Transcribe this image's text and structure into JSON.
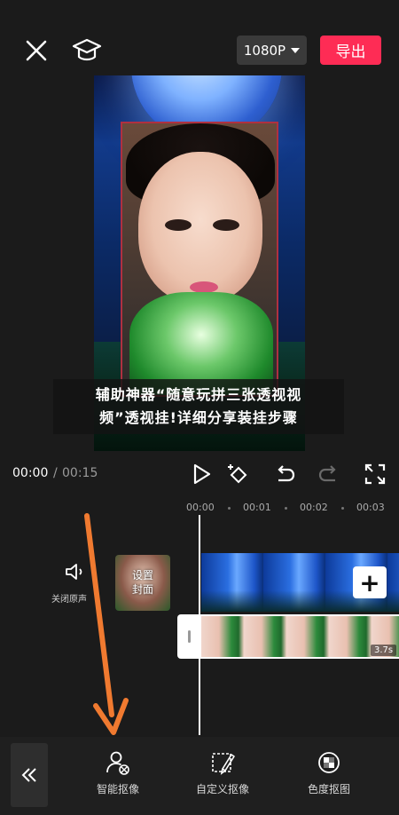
{
  "top_bar": {
    "resolution_label": "1080P",
    "export_label": "导出",
    "export_color": "#fe2c55"
  },
  "caption": {
    "line1": "辅助神器“随意玩拼三张透视视",
    "line2": "频”透视挂!详细分享装挂步骤"
  },
  "playback": {
    "current_time": "00:00",
    "separator": "/",
    "total_time": "00:15"
  },
  "timeline": {
    "ticks": [
      "00:00",
      "00:01",
      "00:02",
      "00:03"
    ],
    "mute_label": "关闭原声",
    "cover_label_line1": "设置",
    "cover_label_line2": "封面",
    "clip_duration": "3.7s"
  },
  "toolbar": {
    "tools": [
      {
        "label": "智能抠像",
        "icon": "smart-cutout-icon"
      },
      {
        "label": "自定义抠像",
        "icon": "custom-cutout-icon"
      },
      {
        "label": "色度抠图",
        "icon": "chroma-key-icon"
      }
    ]
  },
  "icons": {
    "close": "close-icon",
    "course": "graduation-cap-icon",
    "play": "play-icon",
    "keyframe": "keyframe-icon",
    "undo": "undo-icon",
    "redo": "redo-icon",
    "fullscreen": "fullscreen-icon",
    "mute": "speaker-icon",
    "add": "plus-icon",
    "collapse": "double-chevron-left-icon"
  },
  "colors": {
    "background": "#1b1b1b",
    "accent": "#fe2c55",
    "arrow": "#f07a30"
  }
}
